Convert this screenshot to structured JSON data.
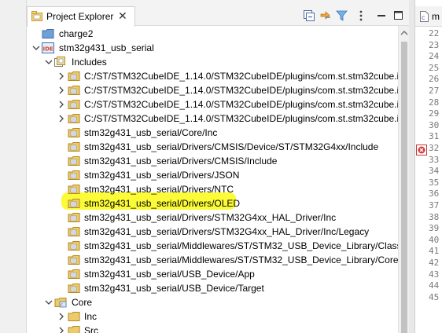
{
  "view": {
    "title": "Project Explorer",
    "close_glyph": "✕"
  },
  "toolbar": {
    "icons": [
      "collapse-all-icon",
      "link-with-editor-icon",
      "filter-icon",
      "view-menu-icon",
      "minimize-icon",
      "maximize-icon"
    ]
  },
  "tree": {
    "items": [
      {
        "label": "charge2",
        "level": 1,
        "twisty": "none",
        "icon": "closed-project"
      },
      {
        "label": "stm32g431_usb_serial",
        "level": 1,
        "twisty": "expanded",
        "icon": "ide-project"
      },
      {
        "label": "Includes",
        "level": 2,
        "twisty": "expanded",
        "icon": "includes"
      },
      {
        "label": "C:/ST/STM32CubeIDE_1.14.0/STM32CubeIDE/plugins/com.st.stm32cube.ide",
        "level": 3,
        "twisty": "collapsed",
        "icon": "include-folder"
      },
      {
        "label": "C:/ST/STM32CubeIDE_1.14.0/STM32CubeIDE/plugins/com.st.stm32cube.ide",
        "level": 3,
        "twisty": "collapsed",
        "icon": "include-folder"
      },
      {
        "label": "C:/ST/STM32CubeIDE_1.14.0/STM32CubeIDE/plugins/com.st.stm32cube.ide",
        "level": 3,
        "twisty": "collapsed",
        "icon": "include-folder"
      },
      {
        "label": "C:/ST/STM32CubeIDE_1.14.0/STM32CubeIDE/plugins/com.st.stm32cube.ide",
        "level": 3,
        "twisty": "collapsed",
        "icon": "include-folder"
      },
      {
        "label": "stm32g431_usb_serial/Core/Inc",
        "level": 3,
        "twisty": "none",
        "icon": "include-folder"
      },
      {
        "label": "stm32g431_usb_serial/Drivers/CMSIS/Device/ST/STM32G4xx/Include",
        "level": 3,
        "twisty": "none",
        "icon": "include-folder"
      },
      {
        "label": "stm32g431_usb_serial/Drivers/CMSIS/Include",
        "level": 3,
        "twisty": "none",
        "icon": "include-folder"
      },
      {
        "label": "stm32g431_usb_serial/Drivers/JSON",
        "level": 3,
        "twisty": "none",
        "icon": "include-folder",
        "highlighted": true
      },
      {
        "label": "stm32g431_usb_serial/Drivers/NTC",
        "level": 3,
        "twisty": "none",
        "icon": "include-folder"
      },
      {
        "label": "stm32g431_usb_serial/Drivers/OLED",
        "level": 3,
        "twisty": "none",
        "icon": "include-folder"
      },
      {
        "label": "stm32g431_usb_serial/Drivers/STM32G4xx_HAL_Driver/Inc",
        "level": 3,
        "twisty": "none",
        "icon": "include-folder"
      },
      {
        "label": "stm32g431_usb_serial/Drivers/STM32G4xx_HAL_Driver/Inc/Legacy",
        "level": 3,
        "twisty": "none",
        "icon": "include-folder"
      },
      {
        "label": "stm32g431_usb_serial/Middlewares/ST/STM32_USB_Device_Library/Class/CD",
        "level": 3,
        "twisty": "none",
        "icon": "include-folder"
      },
      {
        "label": "stm32g431_usb_serial/Middlewares/ST/STM32_USB_Device_Library/Core/Inc",
        "level": 3,
        "twisty": "none",
        "icon": "include-folder"
      },
      {
        "label": "stm32g431_usb_serial/USB_Device/App",
        "level": 3,
        "twisty": "none",
        "icon": "include-folder"
      },
      {
        "label": "stm32g431_usb_serial/USB_Device/Target",
        "level": 3,
        "twisty": "none",
        "icon": "include-folder"
      },
      {
        "label": "Core",
        "level": 2,
        "twisty": "expanded",
        "icon": "source-folder"
      },
      {
        "label": "Inc",
        "level": 3,
        "twisty": "collapsed",
        "icon": "folder"
      },
      {
        "label": "Src",
        "level": 3,
        "twisty": "collapsed",
        "icon": "folder"
      }
    ]
  },
  "editor": {
    "tab_label": "m",
    "line_numbers": [
      "22",
      "23",
      "24",
      "25",
      "26",
      "27",
      "28",
      "29",
      "30",
      "31",
      "32",
      "33",
      "34",
      "35",
      "36",
      "37",
      "38",
      "39",
      "40",
      "41",
      "42",
      "43",
      "44",
      "45"
    ]
  },
  "colors": {
    "highlight": "#fbfb38",
    "selection_tint": "#e4ecf7",
    "folder_yellow": "#e8c15a",
    "folder_blue": "#5b8fd0"
  }
}
